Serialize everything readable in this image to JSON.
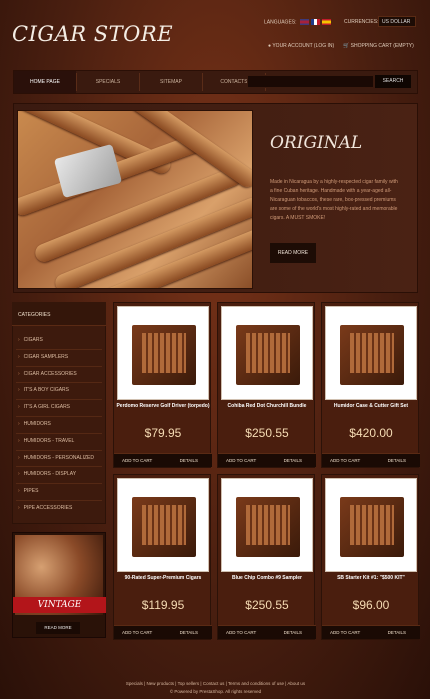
{
  "header": {
    "logo": "CIGAR STORE",
    "languages_label": "LANGUAGES:",
    "currencies_label": "CURRENCIES:",
    "currency_selected": "US DOLLAR",
    "account_label": "YOUR ACCOUNT (LOG IN)",
    "cart_label": "SHOPPING CART (EMPTY)"
  },
  "nav": {
    "items": [
      "HOME PAGE",
      "SPECIALS",
      "SITEMAP",
      "CONTACTS"
    ]
  },
  "search": {
    "button": "SEARCH",
    "placeholder": ""
  },
  "slider": {
    "title": "ORIGINAL",
    "text": "Made in Nicaragua by a highly-respected cigar family with a fine Cuban heritage. Handmade with a year-aged all-Nicaraguan tobaccos, these rare, box-pressed premiums are some of the world's most highly-rated and memorable cigars. A MUST SMOKE!",
    "button": "READ MORE"
  },
  "categories": {
    "title": "CATEGORIES",
    "items": [
      "CIGARS",
      "CIGAR SAMPLERS",
      "CIGAR ACCESSORIES",
      "IT'S A BOY CIGARS",
      "IT'S A GIRL CIGARS",
      "HUMIDORS",
      "HUMIDORS - TRAVEL",
      "HUMIDORS - PERSONALIZED",
      "HUMIDORS - DISPLAY",
      "PIPES",
      "PIPE ACCESSORIES"
    ]
  },
  "promo": {
    "ribbon": "VINTAGE",
    "button": "READ MORE"
  },
  "products": [
    {
      "name": "Perdomo Reserve Golf Driver (torpedo)",
      "price": "$79.95",
      "cart": "ADD TO CART",
      "details": "DETAILS"
    },
    {
      "name": "Cohiba Red Dot Churchill Bundle",
      "price": "$250.55",
      "cart": "ADD TO CART",
      "details": "DETAILS"
    },
    {
      "name": "Humidor Case & Cutter Gift Set",
      "price": "$420.00",
      "cart": "ADD TO CART",
      "details": "DETAILS"
    },
    {
      "name": "90-Rated Super-Premium Cigars",
      "price": "$119.95",
      "cart": "ADD TO CART",
      "details": "DETAILS"
    },
    {
      "name": "Blue Chip Combo #9 Sampler",
      "price": "$250.55",
      "cart": "ADD TO CART",
      "details": "DETAILS"
    },
    {
      "name": "SB Starter Kit #1: \"$500 KIT\"",
      "price": "$96.00",
      "cart": "ADD TO CART",
      "details": "DETAILS"
    }
  ],
  "footer": {
    "links": "Specials  |  New products  |  Top sellers  |  Contact us  |  Terms and conditions of use  |  About us",
    "powered": "© Powered by PrestaShop. All rights reserved"
  }
}
